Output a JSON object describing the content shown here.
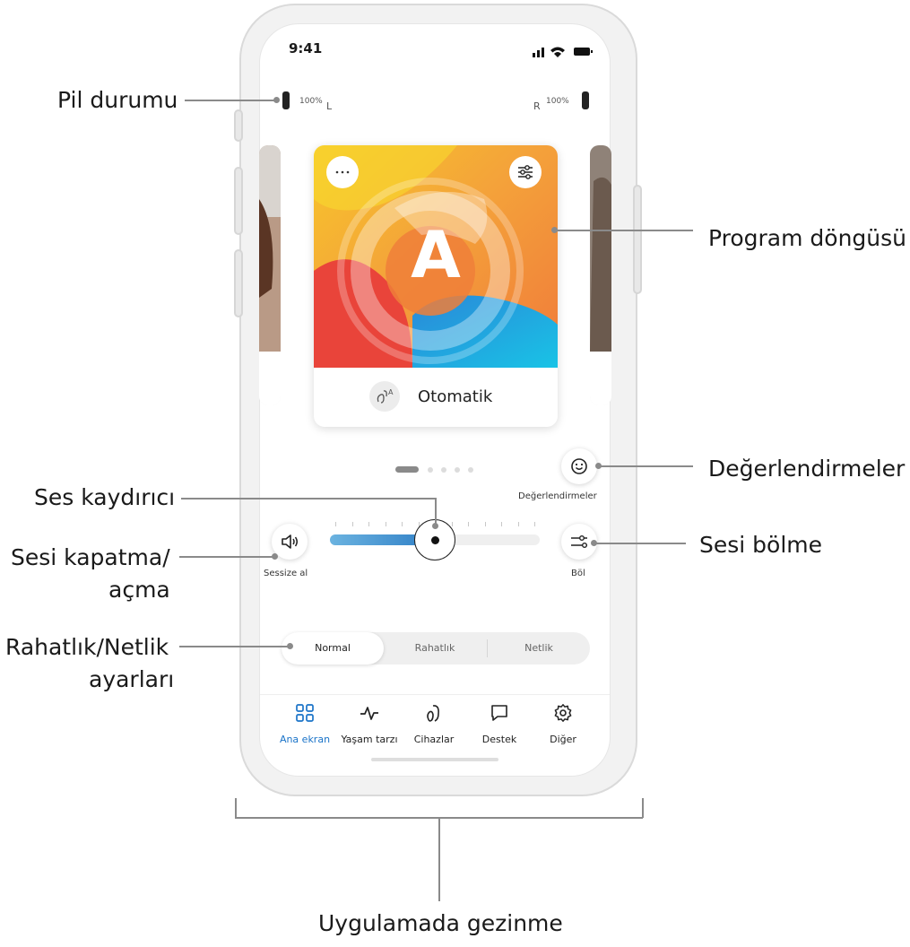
{
  "status_bar": {
    "time": "9:41"
  },
  "battery": {
    "left_value": "100%",
    "left_side": "L",
    "right_value": "100%",
    "right_side": "R"
  },
  "program": {
    "letter": "A",
    "name": "Otomatik"
  },
  "carousel": {
    "page_count": 5,
    "active_index": 0
  },
  "ratings": {
    "caption": "Değerlendirmeler"
  },
  "volume": {
    "mute_caption": "Sessize al",
    "split_caption": "Böl",
    "level_fraction": 0.5
  },
  "mode_selector": {
    "options": [
      "Normal",
      "Rahatlık",
      "Netlik"
    ],
    "active_index": 0
  },
  "navigation": {
    "items": [
      {
        "label": "Ana ekran",
        "icon": "grid-icon",
        "active": true
      },
      {
        "label": "Yaşam tarzı",
        "icon": "activity-icon",
        "active": false
      },
      {
        "label": "Cihazlar",
        "icon": "hearing-aid-icon",
        "active": false
      },
      {
        "label": "Destek",
        "icon": "chat-icon",
        "active": false
      },
      {
        "label": "Diğer",
        "icon": "gear-icon",
        "active": false
      }
    ]
  },
  "callouts": {
    "battery": "Pil durumu",
    "program_cycle": "Program döngüsü",
    "ratings": "Değerlendirmeler",
    "volume_slider": "Ses kaydırıcı",
    "mute_line1": "Sesi kapatma/",
    "mute_line2": "açma",
    "split": "Sesi bölme",
    "comfort_line1": "Rahatlık/Netlik",
    "comfort_line2": "ayarları",
    "navigation": "Uygulamada gezinme"
  },
  "colors": {
    "accent": "#1a73c8",
    "slider_fill": "#3f8fd0",
    "callout_line": "#8a8a8a"
  }
}
